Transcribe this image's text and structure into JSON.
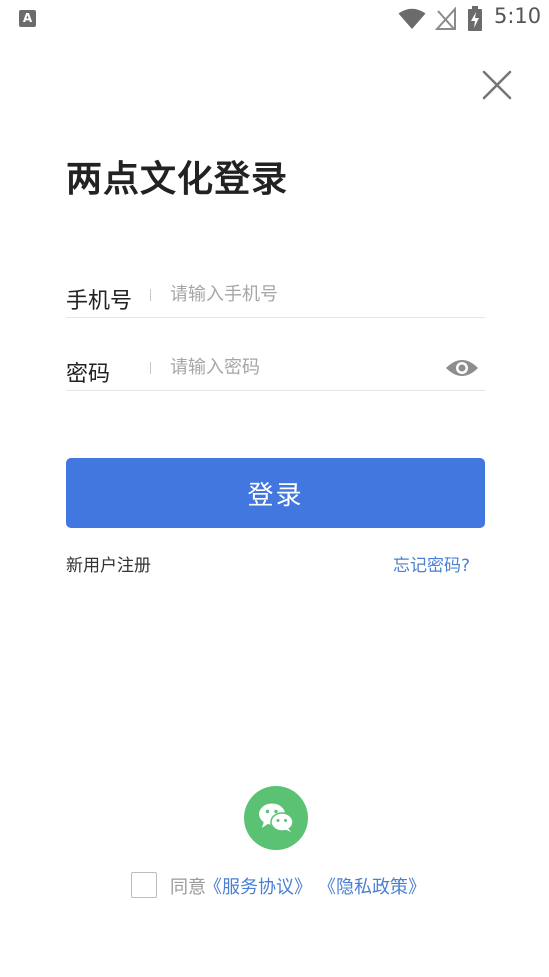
{
  "status_bar": {
    "app_icon_letter": "A",
    "time": "5:10",
    "icons": [
      "wifi-icon",
      "no-signal-icon",
      "battery-charging-icon"
    ]
  },
  "header": {
    "close_icon": "close-icon"
  },
  "title": "两点文化登录",
  "form": {
    "phone": {
      "label": "手机号",
      "placeholder": "请输入手机号",
      "value": ""
    },
    "password": {
      "label": "密码",
      "placeholder": "请输入密码",
      "value": "",
      "toggle_icon": "eye-icon"
    }
  },
  "login_button_label": "登录",
  "links": {
    "register": "新用户注册",
    "forgot": "忘记密码?"
  },
  "social": {
    "wechat_icon": "wechat-icon"
  },
  "agreement": {
    "checked": false,
    "prefix": "同意",
    "service": "《服务协议》",
    "privacy": "《隐私政策》"
  },
  "colors": {
    "primary": "#4277e0",
    "link": "#4a7fd2",
    "wechat": "#5bc274",
    "title": "#222222",
    "placeholder": "#a6a6a6"
  }
}
